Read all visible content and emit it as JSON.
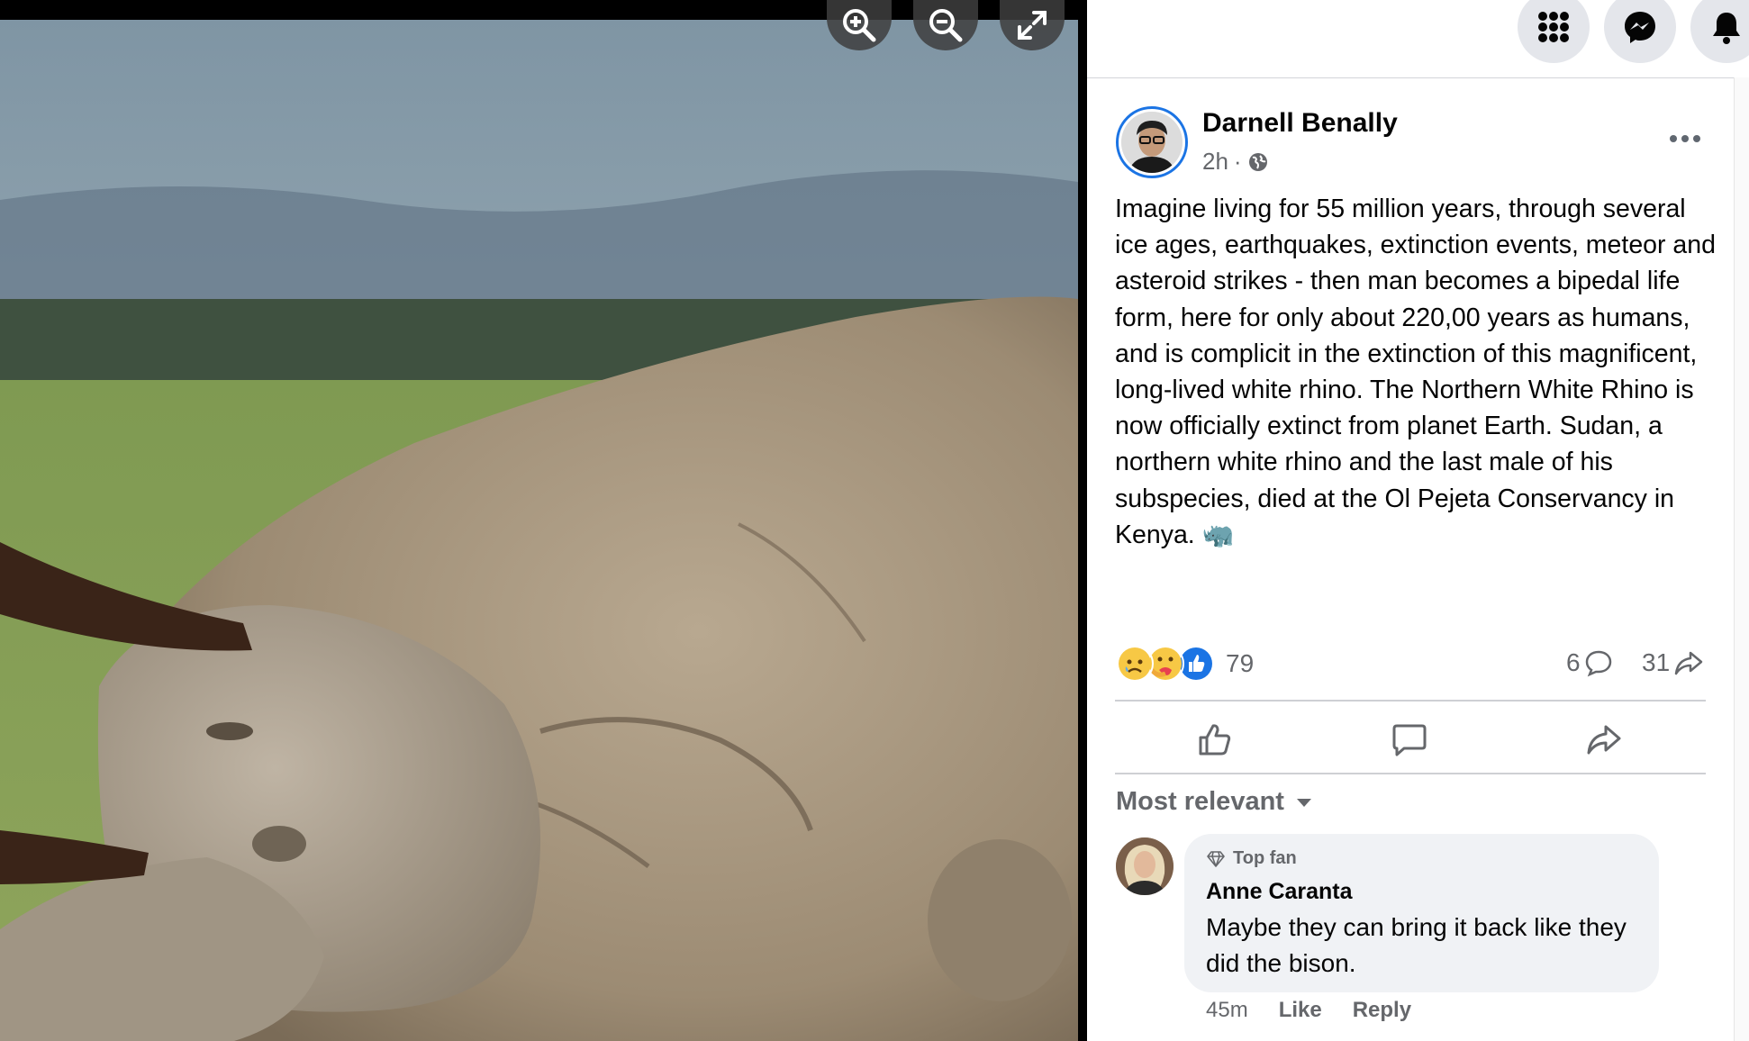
{
  "viewer": {
    "zoom_in_icon": "zoom-in-icon",
    "zoom_out_icon": "zoom-out-icon",
    "fullscreen_icon": "expand-icon"
  },
  "topbar": {
    "menu_icon": "grid-menu-icon",
    "messenger_icon": "messenger-icon",
    "notifications_icon": "bell-icon"
  },
  "post": {
    "author": "Darnell Benally",
    "time": "2h",
    "separator": "·",
    "audience_icon": "globe-icon",
    "text": "Imagine living for 55 million years, through several ice ages, earthquakes, extinction events, meteor and asteroid strikes - then man becomes a bipedal life form, here for only about 220,00 years as humans, and is complicit in the extinction of this magnificent, long-lived white rhino. The Northern White Rhino is now officially extinct from planet Earth. Sudan, a northern white rhino and the last male of his subspecies, died at the Ol Pejeta Conservancy in Kenya. 🦏",
    "reactions": [
      "sad",
      "care",
      "like"
    ],
    "reaction_count": "79",
    "comment_count": "6",
    "share_count": "31",
    "actions": [
      "like-icon",
      "comment-icon",
      "share-icon"
    ]
  },
  "comments": {
    "sort_label": "Most relevant",
    "items": [
      {
        "badge": "Top fan",
        "author": "Anne Caranta",
        "text": "Maybe they can bring it back like they did the bison.",
        "time": "45m",
        "like": "Like",
        "reply": "Reply"
      }
    ]
  },
  "colors": {
    "accent": "#1b74e4",
    "secondary_text": "#65676b",
    "bubble": "#f0f2f5"
  }
}
